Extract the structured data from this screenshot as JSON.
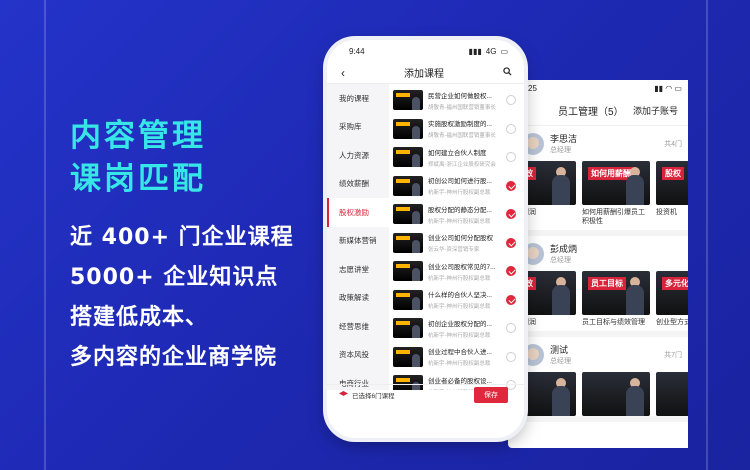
{
  "hero": {
    "line1": "内容管理",
    "line2": "课岗匹配",
    "bullets": [
      "近 400+ 门企业课程",
      "5000+ 企业知识点",
      "搭建低成本、",
      "多内容的企业商学院"
    ]
  },
  "back_card": {
    "status_time": "25",
    "title": "员工管理（5）",
    "add_label": "添加子账号",
    "employees": [
      {
        "name": "李思洁",
        "position": "总经理",
        "count": "共4门",
        "courses": [
          "效要利润",
          "如何用薪酬引爆员工积极性",
          "投资机"
        ],
        "thumb_titles": [
          "绩效",
          "如何用薪酬",
          "股权"
        ]
      },
      {
        "name": "彭成炳",
        "position": "总经理",
        "count": "",
        "courses": [
          "效要利润",
          "员工目标与绩效管理",
          "创业型方式"
        ],
        "thumb_titles": [
          "绩效",
          "员工目标",
          "多元化"
        ]
      },
      {
        "name": "测试",
        "position": "总经理",
        "count": "共7门",
        "courses": [
          "",
          "",
          ""
        ],
        "thumb_titles": [
          "",
          "",
          ""
        ]
      }
    ]
  },
  "phone": {
    "status_time": "9:44",
    "network": "4G",
    "title": "添加课程",
    "categories": [
      "我的课程",
      "采购库",
      "人力资源",
      "绩效薪酬",
      "股权激励",
      "新媒体营销",
      "志愿讲堂",
      "政策解读",
      "经营思维",
      "资本风投",
      "电商行业"
    ],
    "active_category": "股权激励",
    "courses": [
      {
        "title": "民营企业如何做股权...",
        "sub": "胡敬青-福州国联营销董事长",
        "checked": false
      },
      {
        "title": "实施股权激励制度的...",
        "sub": "胡敬青-福州国联营销董事长",
        "checked": false
      },
      {
        "title": "如何建立合伙人制度",
        "sub": "郑斌禹-浙江企业股权研究会",
        "checked": false
      },
      {
        "title": "初创公司如何进行股...",
        "sub": "杭新宇-神州行股权副总裁",
        "checked": true
      },
      {
        "title": "股权分配的静态分配...",
        "sub": "杭新宇-神州行股权副总裁",
        "checked": true
      },
      {
        "title": "创业公司如何分配股权",
        "sub": "张云华-资深营销专家",
        "checked": true
      },
      {
        "title": "创业公司股权常见的7...",
        "sub": "杭新宇-神州行股权副总裁",
        "checked": true
      },
      {
        "title": "什么样的合伙人坚决...",
        "sub": "杭新宇-神州行股权副总裁",
        "checked": true
      },
      {
        "title": "初创企业股权分配的...",
        "sub": "杭新宇-神州行股权副总裁",
        "checked": false
      },
      {
        "title": "创业过程中合伙人进...",
        "sub": "杭新宇-神州行股权副总裁",
        "checked": false
      },
      {
        "title": "创业者必备的股权设...",
        "sub": "杭新宇-神州行股权副总裁",
        "checked": false
      }
    ],
    "selected_text": "已选择6门课程",
    "save_label": "保存"
  },
  "colors": {
    "background": "#1f2bb8",
    "accent": "#37e7e8",
    "brand_red": "#e0283c"
  }
}
